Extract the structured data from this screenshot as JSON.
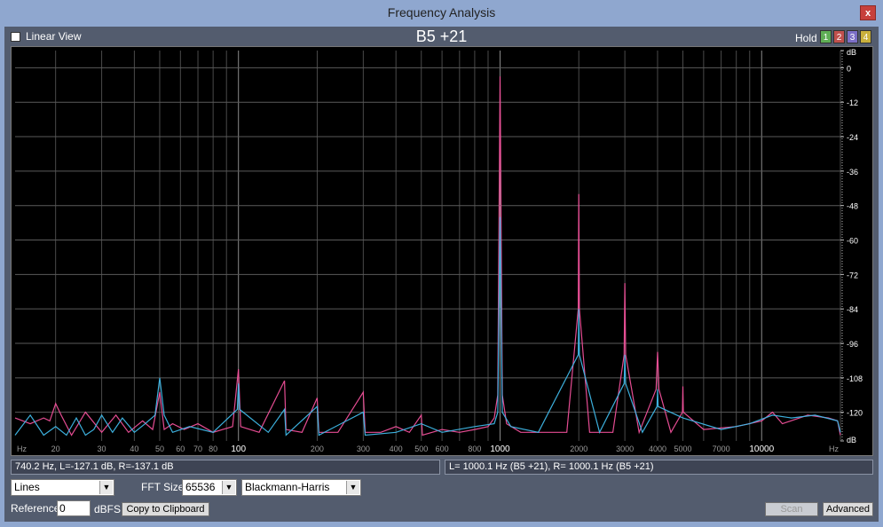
{
  "window": {
    "title": "Frequency Analysis",
    "close_label": "x"
  },
  "toolbar": {
    "linear_view_label": "Linear View",
    "linear_view_checked": false,
    "heading": "B5 +21",
    "hold_label": "Hold",
    "hold_buttons": [
      {
        "label": "1",
        "color": "#5fae55"
      },
      {
        "label": "2",
        "color": "#c0504d"
      },
      {
        "label": "3",
        "color": "#7b6fc6"
      },
      {
        "label": "4",
        "color": "#c9b03c"
      }
    ]
  },
  "chart_data": {
    "type": "line",
    "x_scale": "log",
    "xlim": [
      14,
      20000
    ],
    "ylim": [
      -130,
      6
    ],
    "xlabel": "Hz",
    "ylabel": "dB",
    "x_ticks": [
      {
        "value": 14,
        "label": "Hz"
      },
      {
        "value": 20,
        "label": "20"
      },
      {
        "value": 30,
        "label": "30"
      },
      {
        "value": 40,
        "label": "40"
      },
      {
        "value": 50,
        "label": "50"
      },
      {
        "value": 60,
        "label": "60"
      },
      {
        "value": 70,
        "label": "70"
      },
      {
        "value": 80,
        "label": "80"
      },
      {
        "value": 100,
        "label": "100"
      },
      {
        "value": 200,
        "label": "200"
      },
      {
        "value": 300,
        "label": "300"
      },
      {
        "value": 400,
        "label": "400"
      },
      {
        "value": 500,
        "label": "500"
      },
      {
        "value": 600,
        "label": "600"
      },
      {
        "value": 800,
        "label": "800"
      },
      {
        "value": 1000,
        "label": "1000"
      },
      {
        "value": 2000,
        "label": "2000"
      },
      {
        "value": 3000,
        "label": "3000"
      },
      {
        "value": 4000,
        "label": "4000"
      },
      {
        "value": 5000,
        "label": "5000"
      },
      {
        "value": 7000,
        "label": "7000"
      },
      {
        "value": 10000,
        "label": "10000"
      },
      {
        "value": 20000,
        "label": "Hz"
      }
    ],
    "y_ticks": [
      {
        "value": 6,
        "label": "dB"
      },
      {
        "value": 0,
        "label": "0"
      },
      {
        "value": -12,
        "label": "-12"
      },
      {
        "value": -24,
        "label": "-24"
      },
      {
        "value": -36,
        "label": "-36"
      },
      {
        "value": -48,
        "label": "-48"
      },
      {
        "value": -60,
        "label": "-60"
      },
      {
        "value": -72,
        "label": "-72"
      },
      {
        "value": -84,
        "label": "-84"
      },
      {
        "value": -96,
        "label": "-96"
      },
      {
        "value": -108,
        "label": "-108"
      },
      {
        "value": -120,
        "label": "-120"
      },
      {
        "value": -130,
        "label": "dB"
      }
    ],
    "series": [
      {
        "color": "#f0509a",
        "points": [
          [
            14,
            -122
          ],
          [
            16,
            -124
          ],
          [
            18,
            -122
          ],
          [
            19,
            -123
          ],
          [
            20,
            -117
          ],
          [
            21,
            -121
          ],
          [
            23,
            -128
          ],
          [
            26,
            -120
          ],
          [
            30,
            -127
          ],
          [
            34,
            -121
          ],
          [
            38,
            -127
          ],
          [
            43,
            -123
          ],
          [
            47,
            -126
          ],
          [
            50,
            -113
          ],
          [
            52,
            -126
          ],
          [
            56,
            -124
          ],
          [
            62,
            -126
          ],
          [
            70,
            -124
          ],
          [
            80,
            -127
          ],
          [
            95,
            -125
          ],
          [
            100,
            -105
          ],
          [
            102,
            -125
          ],
          [
            120,
            -127
          ],
          [
            150,
            -109
          ],
          [
            152,
            -126
          ],
          [
            175,
            -127
          ],
          [
            200,
            -115
          ],
          [
            203,
            -127
          ],
          [
            240,
            -127
          ],
          [
            300,
            -113
          ],
          [
            305,
            -127
          ],
          [
            350,
            -127
          ],
          [
            400,
            -125
          ],
          [
            450,
            -127
          ],
          [
            500,
            -121
          ],
          [
            505,
            -128
          ],
          [
            600,
            -126
          ],
          [
            700,
            -127
          ],
          [
            800,
            -126
          ],
          [
            900,
            -125
          ],
          [
            950,
            -122
          ],
          [
            980,
            -114
          ],
          [
            1000,
            -3
          ],
          [
            1020,
            -114
          ],
          [
            1060,
            -124
          ],
          [
            1200,
            -127
          ],
          [
            1500,
            -127
          ],
          [
            1800,
            -127
          ],
          [
            1990,
            -84
          ],
          [
            2000,
            -44
          ],
          [
            2010,
            -84
          ],
          [
            2200,
            -127
          ],
          [
            2700,
            -127
          ],
          [
            2980,
            -100
          ],
          [
            3000,
            -75
          ],
          [
            3020,
            -100
          ],
          [
            3400,
            -127
          ],
          [
            3950,
            -112
          ],
          [
            4000,
            -99
          ],
          [
            4050,
            -112
          ],
          [
            4500,
            -127
          ],
          [
            4980,
            -120
          ],
          [
            5000,
            -111
          ],
          [
            5020,
            -120
          ],
          [
            6000,
            -126
          ],
          [
            8000,
            -125
          ],
          [
            10000,
            -123
          ],
          [
            11000,
            -120
          ],
          [
            12000,
            -124
          ],
          [
            15000,
            -121
          ],
          [
            18000,
            -122
          ],
          [
            19500,
            -123
          ],
          [
            20000,
            -128
          ]
        ]
      },
      {
        "color": "#3fb8e8",
        "points": [
          [
            14,
            -128
          ],
          [
            16,
            -121
          ],
          [
            18,
            -128
          ],
          [
            20,
            -125
          ],
          [
            22,
            -128
          ],
          [
            24,
            -122
          ],
          [
            26,
            -128
          ],
          [
            28,
            -126
          ],
          [
            30,
            -121
          ],
          [
            33,
            -127
          ],
          [
            36,
            -122
          ],
          [
            40,
            -127
          ],
          [
            44,
            -124
          ],
          [
            48,
            -121
          ],
          [
            50,
            -108
          ],
          [
            52,
            -121
          ],
          [
            56,
            -127
          ],
          [
            65,
            -125
          ],
          [
            80,
            -127
          ],
          [
            99,
            -119
          ],
          [
            100,
            -110
          ],
          [
            101,
            -119
          ],
          [
            130,
            -127
          ],
          [
            150,
            -119
          ],
          [
            152,
            -128
          ],
          [
            200,
            -118
          ],
          [
            203,
            -128
          ],
          [
            300,
            -120
          ],
          [
            305,
            -128
          ],
          [
            400,
            -127
          ],
          [
            500,
            -124
          ],
          [
            600,
            -127
          ],
          [
            800,
            -125
          ],
          [
            950,
            -124
          ],
          [
            980,
            -120
          ],
          [
            1000,
            -52
          ],
          [
            1020,
            -120
          ],
          [
            1100,
            -125
          ],
          [
            1400,
            -127
          ],
          [
            1990,
            -100
          ],
          [
            2000,
            -84
          ],
          [
            2010,
            -100
          ],
          [
            2400,
            -127
          ],
          [
            2980,
            -110
          ],
          [
            3000,
            -100
          ],
          [
            3020,
            -110
          ],
          [
            3500,
            -127
          ],
          [
            3980,
            -118
          ],
          [
            4000,
            -112
          ],
          [
            4020,
            -118
          ],
          [
            5000,
            -122
          ],
          [
            7000,
            -126
          ],
          [
            9000,
            -124
          ],
          [
            11000,
            -121
          ],
          [
            13000,
            -122
          ],
          [
            16000,
            -121
          ],
          [
            19500,
            -123
          ],
          [
            20000,
            -127
          ]
        ]
      }
    ]
  },
  "status": {
    "left": "740.2 Hz, L=-127.1 dB, R=-137.1 dB",
    "right": "L= 1000.1 Hz (B5 +21), R= 1000.1 Hz (B5 +21)"
  },
  "controls": {
    "mode": "Lines",
    "fft_size_label": "FFT Size",
    "fft_size": "65536",
    "window_function": "Blackmann-Harris",
    "reference_label": "Reference",
    "reference_value": "0",
    "reference_unit": "dBFS",
    "copy_button": "Copy to Clipboard",
    "scan_button": "Scan",
    "advanced_button": "Advanced"
  }
}
